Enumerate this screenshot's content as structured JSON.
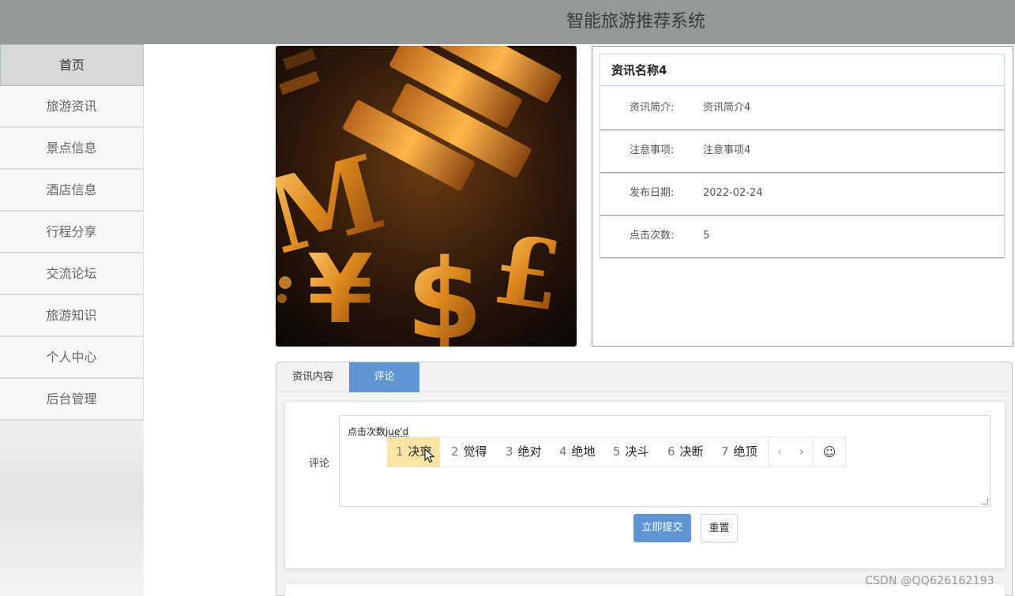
{
  "app": {
    "title": "智能旅游推荐系统"
  },
  "sidebar": {
    "items": [
      {
        "label": "首页"
      },
      {
        "label": "旅游资讯"
      },
      {
        "label": "景点信息"
      },
      {
        "label": "酒店信息"
      },
      {
        "label": "行程分享"
      },
      {
        "label": "交流论坛"
      },
      {
        "label": "旅游知识"
      },
      {
        "label": "个人中心"
      },
      {
        "label": "后台管理"
      }
    ]
  },
  "article": {
    "name": "资讯名称4",
    "rows": [
      {
        "label": "资讯简介:",
        "value": "资讯简介4"
      },
      {
        "label": "注意事项:",
        "value": "注意事项4"
      },
      {
        "label": "发布日期:",
        "value": "2022-02-24"
      },
      {
        "label": "点击次数:",
        "value": "5"
      }
    ]
  },
  "tabs": [
    {
      "label": "资讯内容"
    },
    {
      "label": "评论"
    }
  ],
  "comment": {
    "label": "评论",
    "typed_text": "点击次数",
    "composition": "jue'd",
    "submit_label": "立即提交",
    "reset_label": "重置"
  },
  "ime": {
    "candidates": [
      {
        "num": "1",
        "text": "决窍"
      },
      {
        "num": "2",
        "text": "觉得"
      },
      {
        "num": "3",
        "text": "绝对"
      },
      {
        "num": "4",
        "text": "绝地"
      },
      {
        "num": "5",
        "text": "决斗"
      },
      {
        "num": "6",
        "text": "决断"
      },
      {
        "num": "7",
        "text": "绝顶"
      }
    ],
    "prev": "‹",
    "next": "›",
    "emoji": "☺"
  },
  "watermark": "CSDN @QQ626162193",
  "colors": {
    "accent": "#5f95d4",
    "header": "#949898",
    "ime_selected": "#fde4a5"
  }
}
